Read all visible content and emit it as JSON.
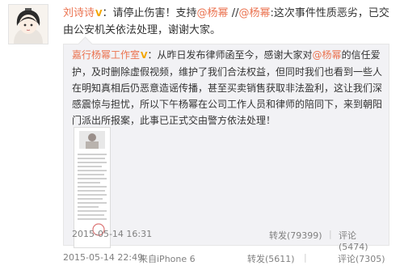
{
  "post": {
    "author": "刘诗诗",
    "verified_badge": "V",
    "text_a": "：请停止伤害！支持",
    "mention_1": "@杨幂",
    "text_b": " //",
    "mention_2": "@杨幂",
    "text_c": ":这次事件性质恶劣，已交由公安机关依法处理，谢谢大家。"
  },
  "repost": {
    "author": "嘉行杨幂工作室",
    "verified_badge": "V",
    "text_a": "：从昨日发布律师函至今，感谢大家对",
    "mention": "@杨幂",
    "text_b": "的信任爱护，及时删除虚假视频，维护了我们合法权益，但同时我们也看到一些人在明知真相后仍恶意造谣传播，甚至买卖销售获取非法盈利，这让我们深感震惊与担忧，所以下午杨幂在公司工作人员和律师的陪同下，来到朝阳门派出所报案，此事已正式交由警方依法处理！",
    "time": "2015-05-14 16:31",
    "repost_label": "转发(79399)",
    "comment_label": "评论(5474)"
  },
  "footer": {
    "time": "2015-05-14 22:49",
    "source": "来自iPhone 6",
    "repost_label": "转发(5611)",
    "comment_label": "评论(7305)"
  }
}
